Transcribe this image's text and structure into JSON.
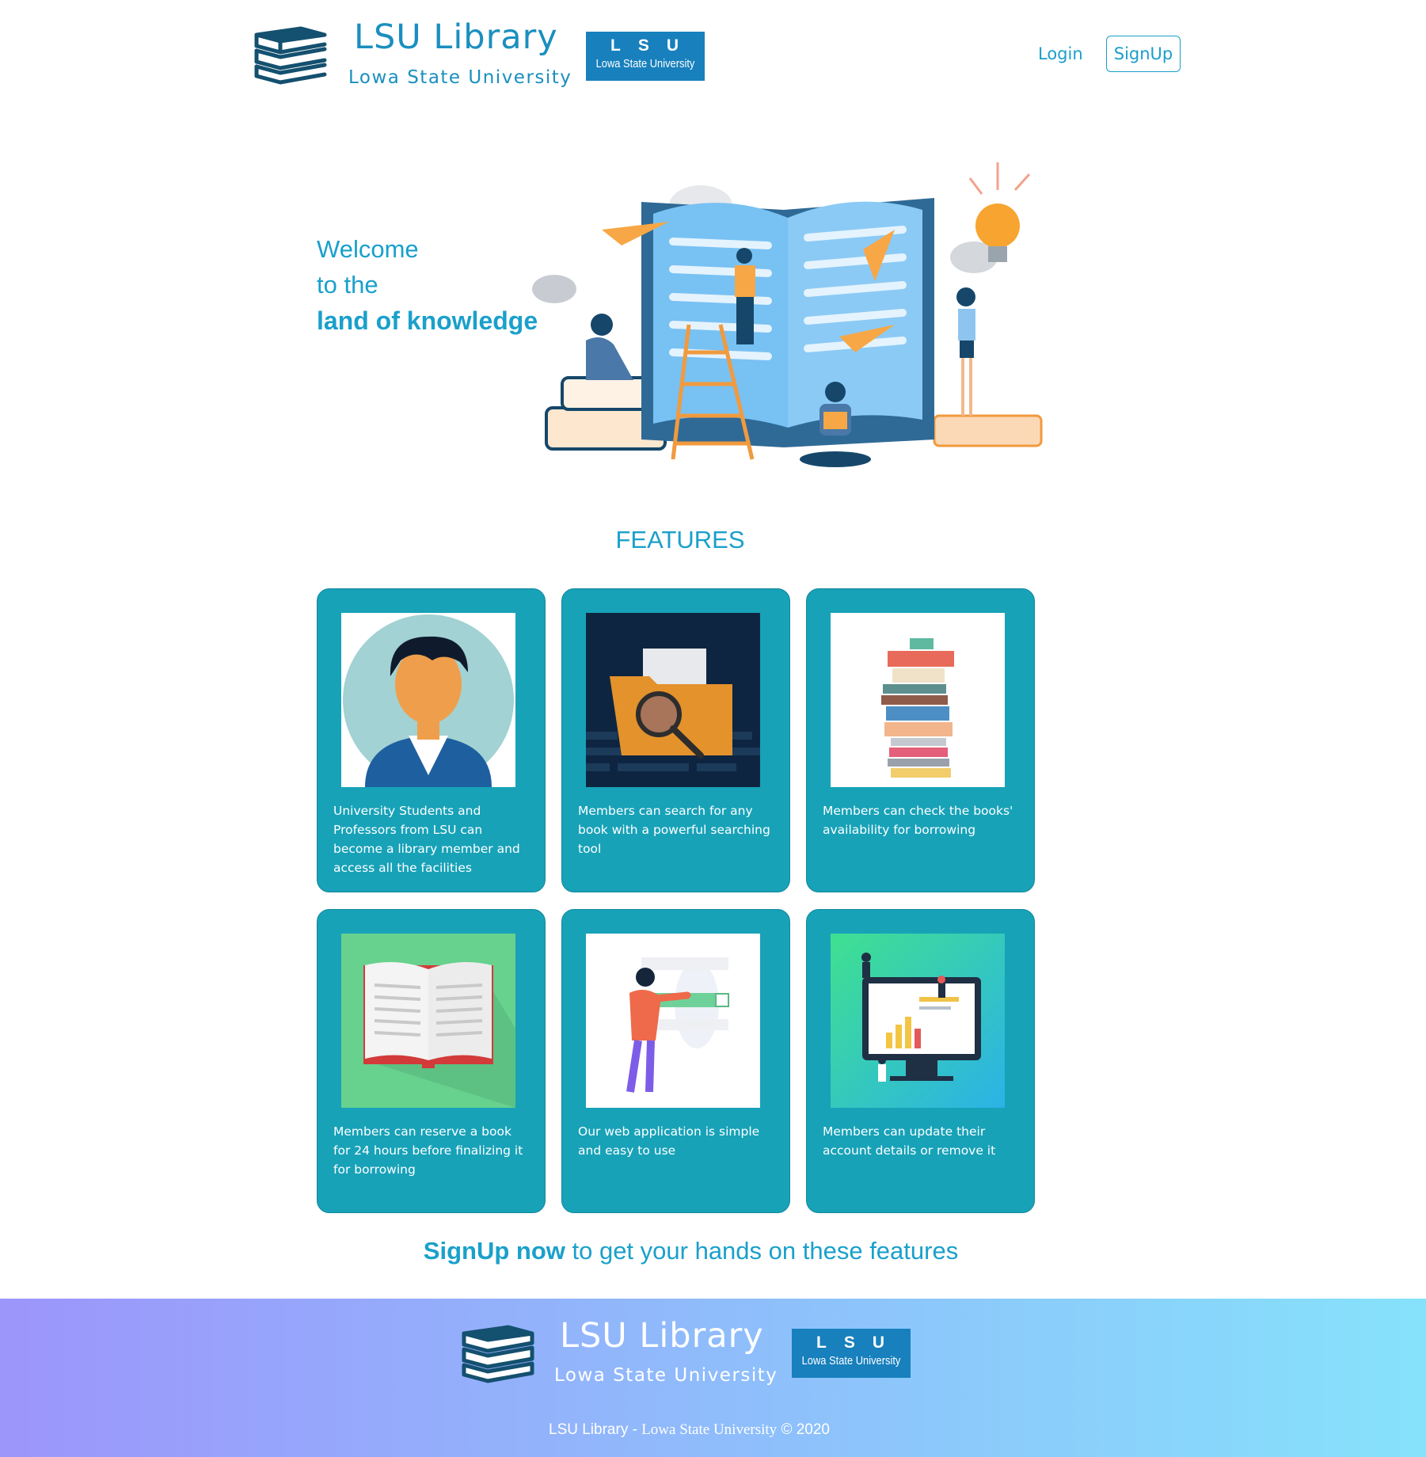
{
  "header": {
    "brand_title": "LSU Library",
    "brand_subtitle": "Lowa State University",
    "badge_letters": "LSU",
    "badge_university": "Lowa State University",
    "login_label": "Login",
    "signup_label": "SignUp"
  },
  "hero": {
    "line1": "Welcome",
    "line2": "to the",
    "line3": "land of knowledge"
  },
  "features": {
    "title": "FEATURES",
    "cards": [
      {
        "text": "University Students and Professors from LSU can become a library member and access all the facilities",
        "icon": "student-avatar-icon"
      },
      {
        "text": "Members can search for any book with a powerful searching tool",
        "icon": "folder-search-icon"
      },
      {
        "text": "Members can check the books' availability for borrowing",
        "icon": "book-stack-icon"
      },
      {
        "text": "Members can reserve a book for 24 hours before finalizing it for borrowing",
        "icon": "open-book-icon"
      },
      {
        "text": "Our web application is simple and easy to use",
        "icon": "checklist-person-icon"
      },
      {
        "text": "Members can update their account details or remove it",
        "icon": "account-dashboard-icon"
      }
    ]
  },
  "cta": {
    "strong": "SignUp now",
    "rest": " to get your hands on these features"
  },
  "footer": {
    "brand_title": "LSU Library",
    "brand_subtitle": "Lowa State University",
    "badge_letters": "LSU",
    "badge_university": "Lowa State University",
    "copyright_sans": "LSU Library - ",
    "copyright_serif": "Lowa State University",
    "copyright_year": " © 2020"
  },
  "colors": {
    "accent": "#1aa0cb",
    "card_bg": "#17a2b8",
    "badge_bg": "#1780bd",
    "footer_gradient_start": "#9c95fb",
    "footer_gradient_end": "#86e2fb"
  }
}
